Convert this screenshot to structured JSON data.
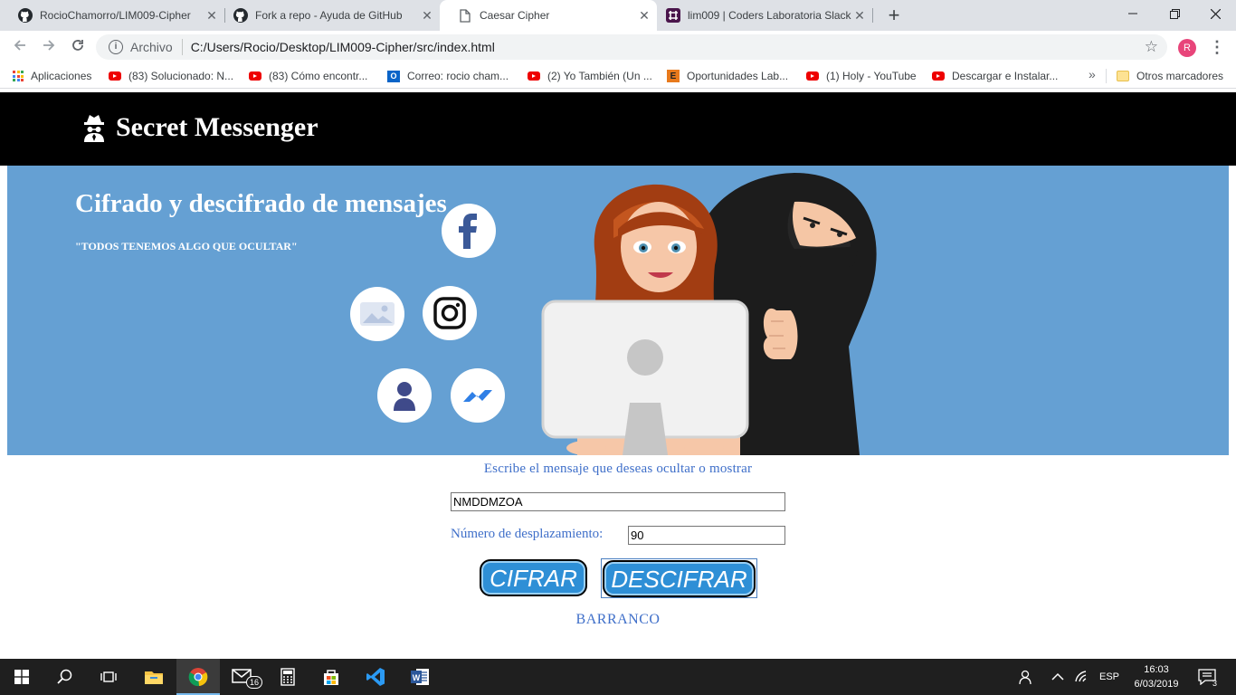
{
  "browser": {
    "tabs": [
      {
        "title": "RocioChamorro/LIM009-Cipher",
        "icon": "github-icon",
        "active": false
      },
      {
        "title": "Fork a repo - Ayuda de GitHub",
        "icon": "github-icon",
        "active": false
      },
      {
        "title": "Caesar Cipher",
        "icon": "document-icon",
        "active": true
      },
      {
        "title": "lim009 | Coders Laboratoria Slack",
        "icon": "slack-icon",
        "active": false
      }
    ],
    "close_glyph": "✕",
    "new_tab_glyph": "+",
    "address": {
      "scheme_label": "Archivo",
      "url": "C:/Users/Rocio/Desktop/LIM009-Cipher/src/index.html"
    },
    "profile_initial": "R",
    "bookmarks": [
      {
        "label": "Aplicaciones",
        "icon": "apps-grid-icon"
      },
      {
        "label": "(83) Solucionado: N...",
        "icon": "youtube-icon"
      },
      {
        "label": "(83) Cómo encontr...",
        "icon": "youtube-icon"
      },
      {
        "label": "Correo: rocio cham...",
        "icon": "outlook-icon"
      },
      {
        "label": "(2) Yo También (Un ...",
        "icon": "youtube-icon"
      },
      {
        "label": "Oportunidades Lab...",
        "icon": "e-icon"
      },
      {
        "label": "(1) Holy - YouTube",
        "icon": "youtube-icon"
      },
      {
        "label": "Descargar e Instalar...",
        "icon": "youtube-icon"
      }
    ],
    "bookmarks_overflow": "»",
    "other_bookmarks": "Otros marcadores"
  },
  "site": {
    "brand_title": "Secret Messenger",
    "hero_title": "Cifrado y descifrado de mensajes",
    "hero_subtitle": "\"TODOS TENEMOS ALGO QUE OCULTAR\"",
    "message_prompt": "Escribe el mensaje que deseas ocultar o mostrar",
    "message_value": "NMDDMZOA",
    "shift_label": "Número de desplazamiento:",
    "shift_value": "90",
    "encrypt_label": "CIFRAR",
    "decrypt_label": "DESCIFRAR",
    "footer": "BARRANCO",
    "colors": {
      "hero_bg": "#65a0d3",
      "header_bg": "#000000",
      "button_bg": "#2e8fd6",
      "text_blue": "#3f6fc9"
    }
  },
  "taskbar": {
    "mail_badge": "16",
    "language": "ESP",
    "time": "16:03",
    "date": "6/03/2019",
    "notification_count": "3"
  }
}
